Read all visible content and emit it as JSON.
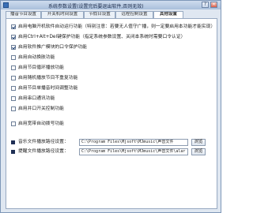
{
  "window": {
    "title": "系统参数设置(设置完后要退出软件,否则无效)",
    "help_glyph": "?",
    "close_glyph": "×"
  },
  "tabs": [
    {
      "label": "播音节目设置",
      "active": false
    },
    {
      "label": "开关机时间设置",
      "active": false
    },
    {
      "label": "节假日设置",
      "active": false
    },
    {
      "label": "远程控制设置",
      "active": false
    },
    {
      "label": "其他设置",
      "active": true
    }
  ],
  "options": [
    {
      "label": "启用电脑开机软件自动运行功能（特别注意：若要无人值守广播，则一定要启用本功能才能实现）",
      "checked": true
    },
    {
      "label": "启用Ctrl+Alt+Del键保护功能（指定系统参数设置、关闭本系统时需要口令认证）",
      "checked": true
    },
    {
      "label": "启用软件推广模块的口令保护功能",
      "checked": true
    },
    {
      "label": "启用自动换肤功能",
      "checked": false
    },
    {
      "label": "启用节目循环播放功能",
      "checked": false
    },
    {
      "label": "启用随机播放节目不重复功能",
      "checked": false
    },
    {
      "label": "启用节目单播音时间调整功能",
      "checked": false
    },
    {
      "label": "启用串口通讯功能",
      "checked": false
    },
    {
      "label": "启用并口开关控制功能",
      "checked": false
    },
    {
      "label": "启用宽带自动拨号功能",
      "checked": false
    }
  ],
  "paths": [
    {
      "label": "音乐文件播放路径设置：",
      "value": "C:\\Program Files\\Mjsoft\\MJmusic\\声音文件",
      "button": "浏览"
    },
    {
      "label": "提醒文件播放路径设置：",
      "value": "C:\\Program Files\\Mjsoft\\MJmusic\\声音文件\\alar",
      "button": "浏览"
    }
  ],
  "colors": {
    "accent": "#1f2f55",
    "window_bg": "#dfe7f1",
    "title_gradient_top": "#cfdcee"
  }
}
